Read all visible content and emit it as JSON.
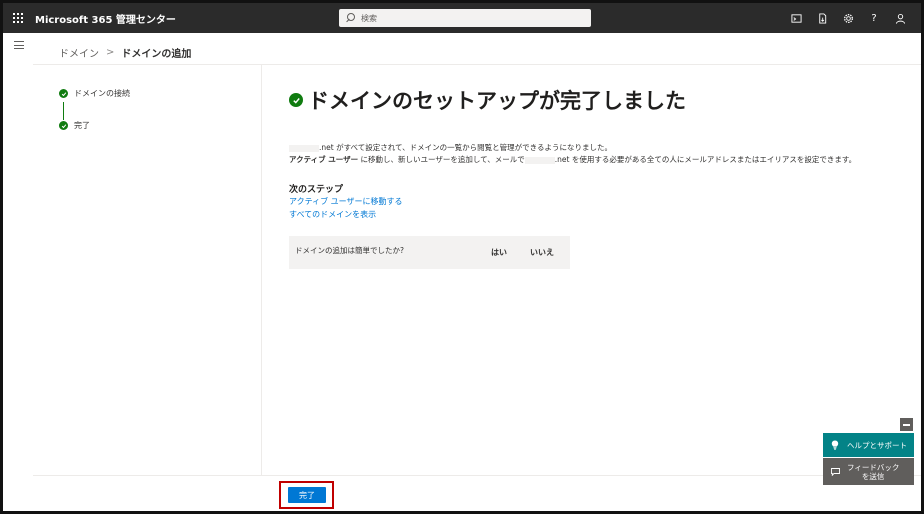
{
  "topbar": {
    "app_title": "Microsoft 365 管理センター",
    "search_placeholder": "検索",
    "help_glyph": "?"
  },
  "breadcrumb": {
    "parent": "ドメイン",
    "separator": ">",
    "current": "ドメインの追加"
  },
  "steps": [
    {
      "label": "ドメインの接続",
      "status": "completed"
    },
    {
      "label": "完了",
      "status": "completed"
    }
  ],
  "main": {
    "heading": "ドメインのセットアップが完了しました",
    "desc_line1": ".net がすべて設定されて、ドメインの一覧から閲覧と管理ができるようになりました。",
    "desc_line2_a": "アクティブ ユーザー",
    "desc_line2_b": " に移動し、新しいユーザーを追加して、メールで",
    "desc_line2_c": ".net を使用する必要がある全ての人にメールアドレスまたはエイリアスを設定できます。",
    "next_steps_title": "次のステップ",
    "links": [
      "アクティブ ユーザーに移動する",
      "すべてのドメインを表示"
    ]
  },
  "feedback": {
    "question": "ドメインの追加は簡単でしたか?",
    "yes": "はい",
    "no": "いいえ"
  },
  "footer": {
    "done_label": "完了"
  },
  "help_panel": {
    "help_label": "ヘルプとサポート",
    "feedback_line1": "フィードバック",
    "feedback_line2": "を送信"
  },
  "colors": {
    "topbar": "#2b2b2b",
    "accent": "#0078d4",
    "success": "#107c10",
    "help_teal": "#038387",
    "highlight_red": "#c00000"
  }
}
